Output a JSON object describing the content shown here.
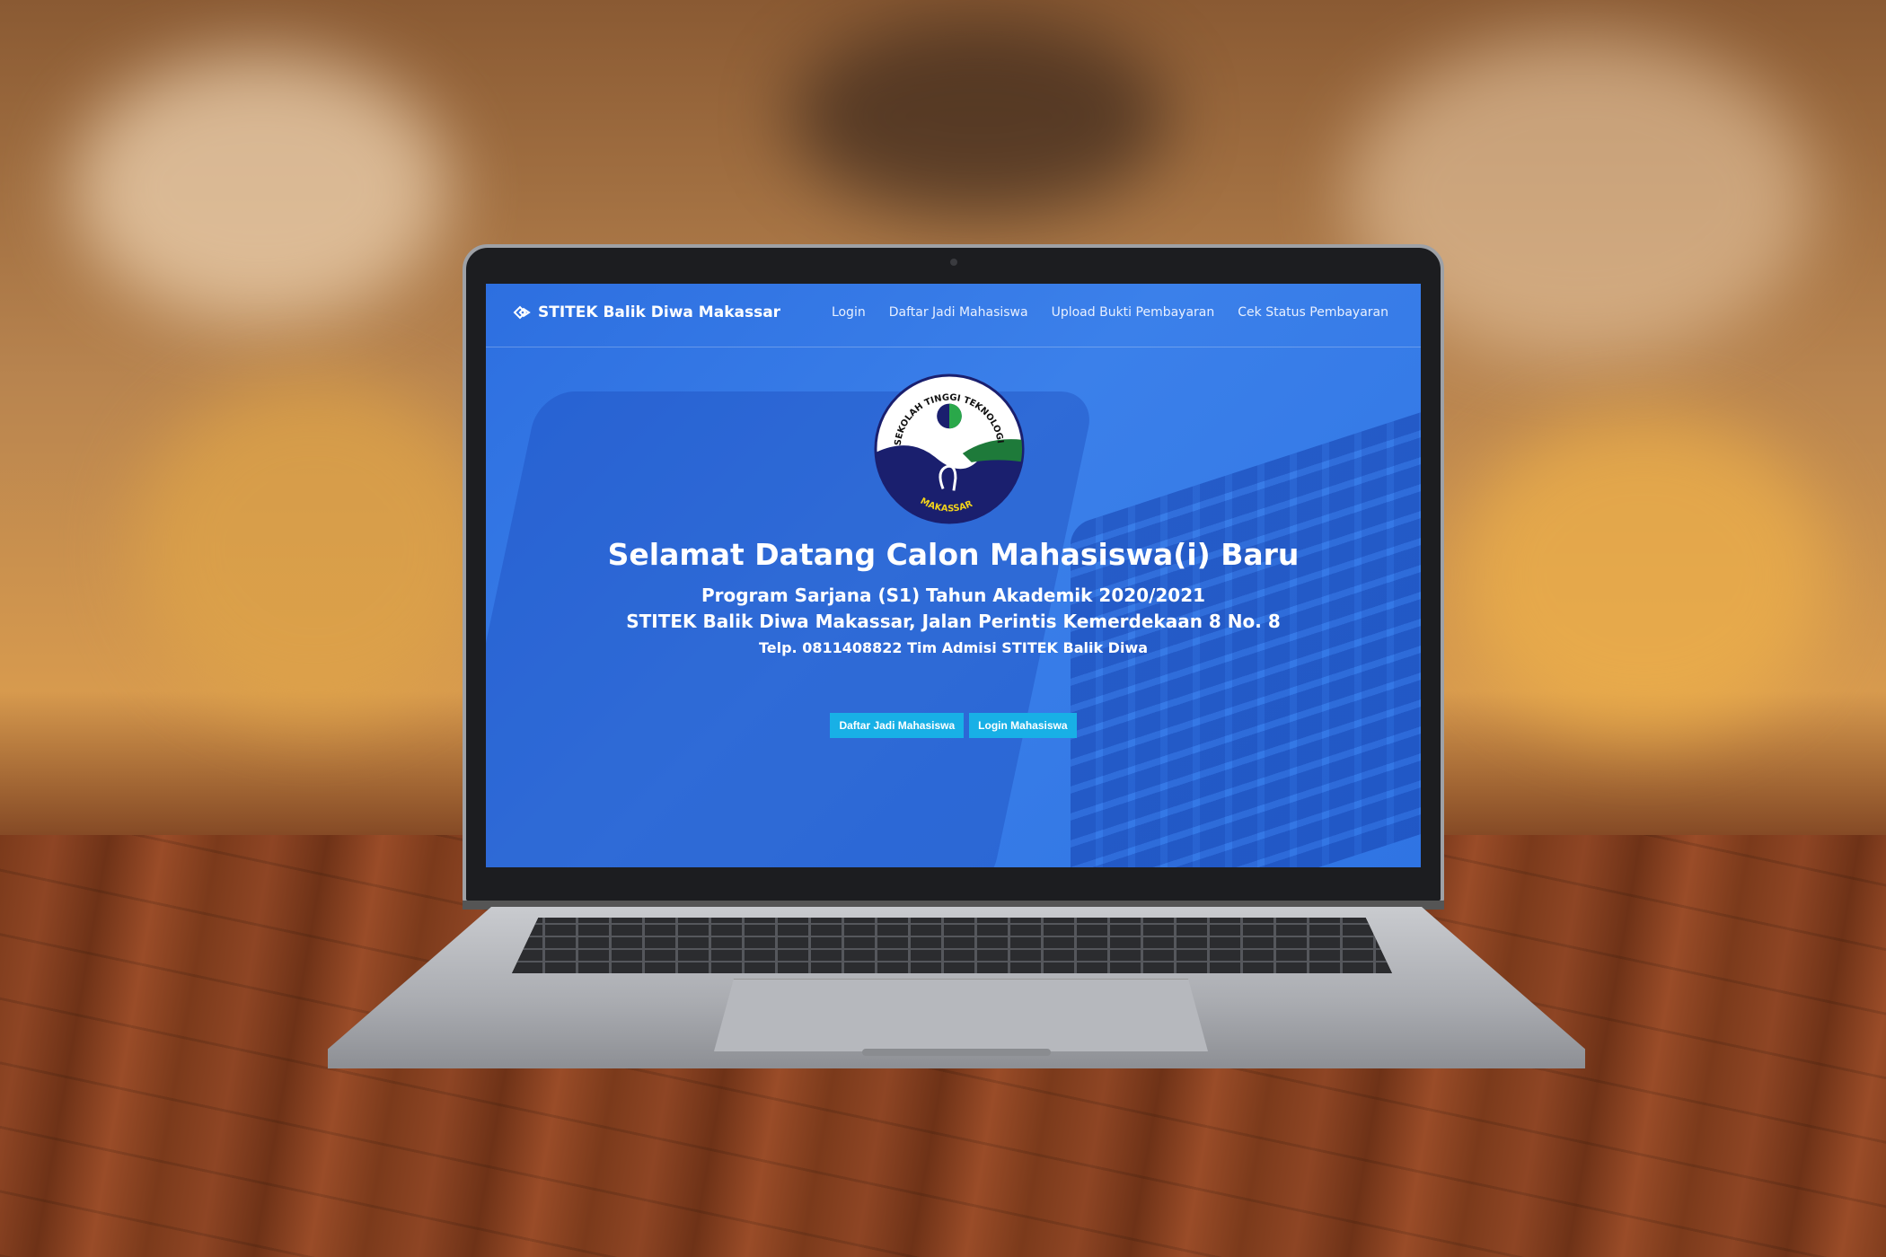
{
  "navbar": {
    "brand": "STITEK Balik Diwa Makassar",
    "links": [
      "Login",
      "Daftar Jadi Mahasiswa",
      "Upload Bukti Pembayaran",
      "Cek Status Pembayaran"
    ]
  },
  "logo": {
    "arc_text": "SEKOLAH TINGGI TEKNOLOGI KELAUTAN",
    "bottom_text": "MAKASSAR"
  },
  "hero": {
    "title": "Selamat Datang Calon Mahasiswa(i) Baru",
    "subtitle_1": "Program Sarjana (S1) Tahun Akademik 2020/2021",
    "subtitle_2": "STITEK Balik Diwa Makassar, Jalan Perintis Kemerdekaan 8 No. 8",
    "contact": "Telp. 0811408822 Tim Admisi STITEK Balik Diwa"
  },
  "buttons": {
    "register": "Daftar Jadi Mahasiswa",
    "login": "Login Mahasiswa"
  },
  "colors": {
    "screen_blue": "#2f74e3",
    "button_cyan": "#18b0e6",
    "logo_navy": "#1a1f6e"
  }
}
